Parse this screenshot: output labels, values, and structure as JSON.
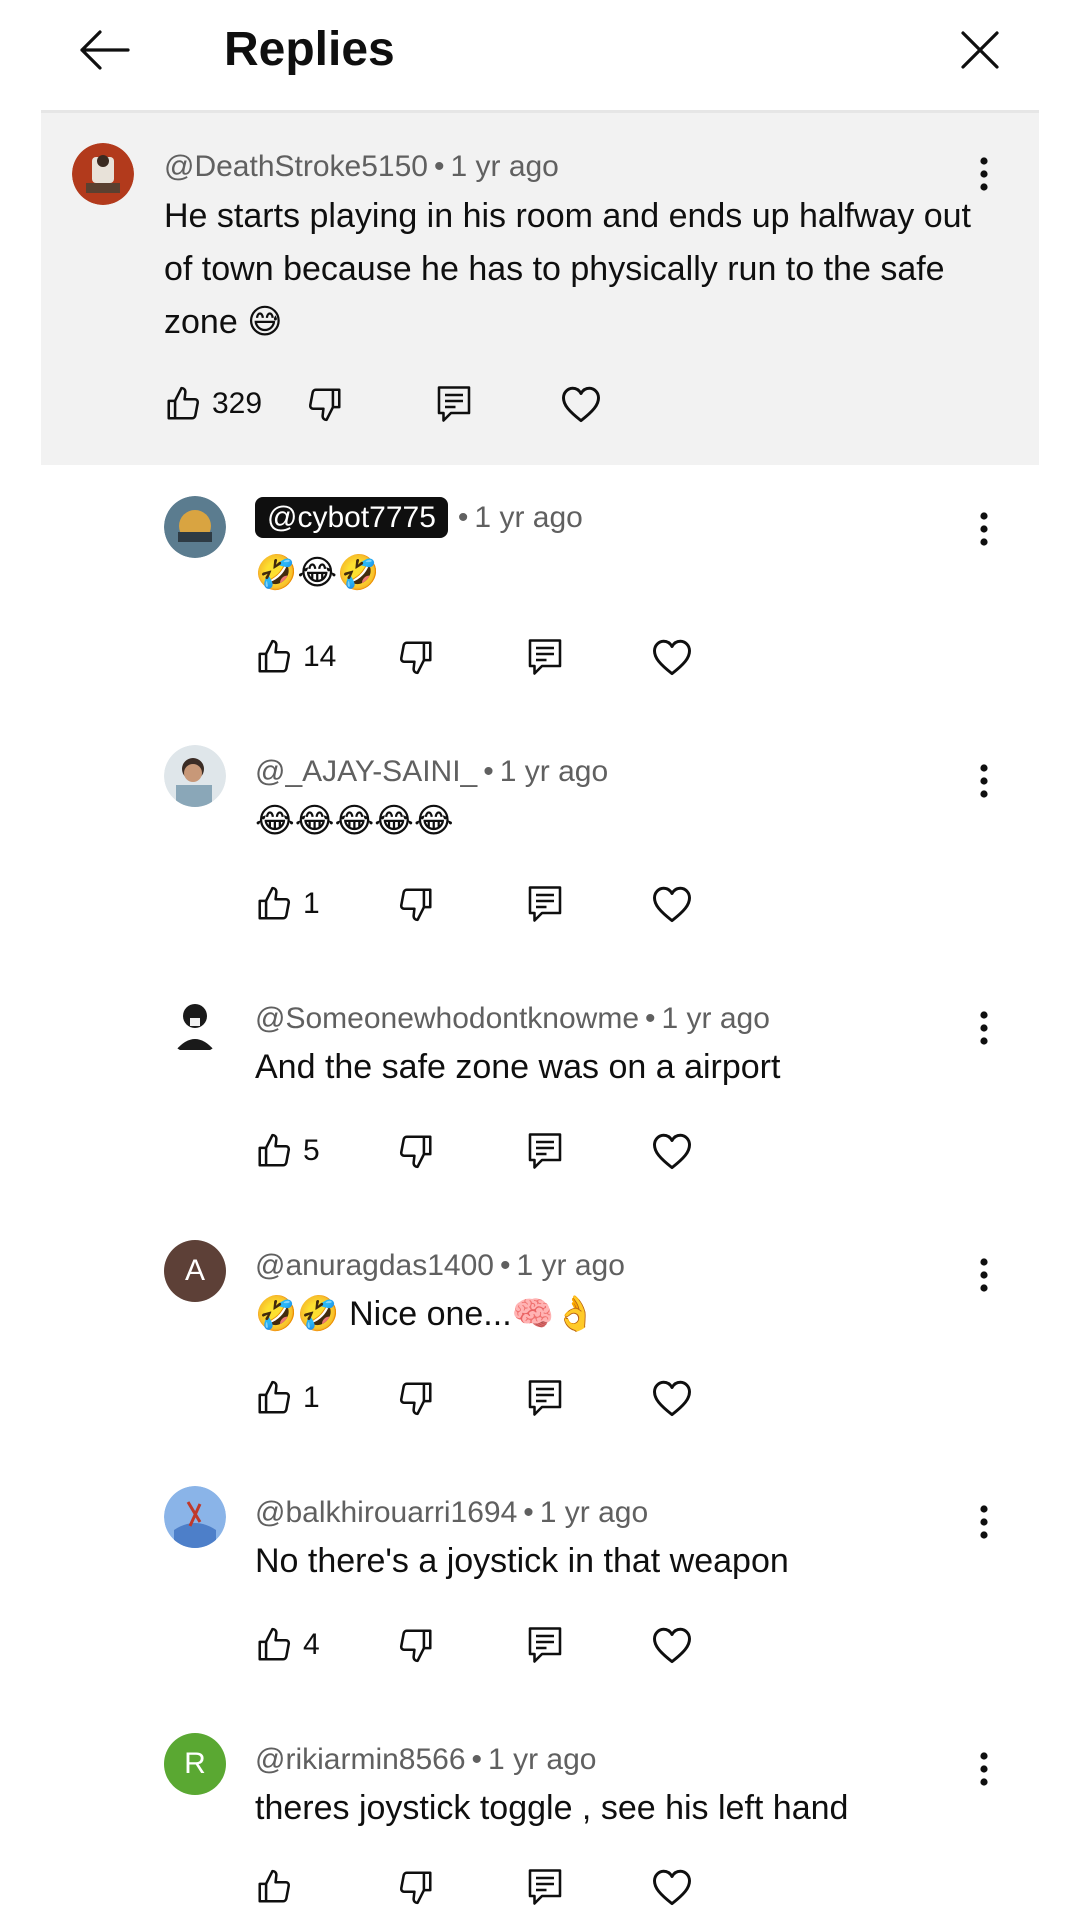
{
  "header": {
    "title": "Replies",
    "back_icon": "arrow-left-icon",
    "close_icon": "close-icon"
  },
  "parent_comment": {
    "handle": "@DeathStroke5150",
    "time": "1 yr ago",
    "text": "He starts playing in his room and ends up halfway out of town because he has to physically run to the safe zone 😅",
    "likes": "329"
  },
  "replies": [
    {
      "handle": "@cybot7775",
      "time": "1 yr ago",
      "text": "🤣😂🤣",
      "likes": "14",
      "highlight_handle": true
    },
    {
      "handle": "@_AJAY-SAINI_",
      "time": "1 yr ago",
      "text": "😂😂😂😂😂",
      "likes": "1"
    },
    {
      "handle": "@Someonewhodontknowme",
      "time": "1 yr ago",
      "text": "And the safe zone was on a airport",
      "likes": "5"
    },
    {
      "handle": "@anuragdas1400",
      "time": "1 yr ago",
      "text": "🤣🤣 Nice one...🧠👌",
      "likes": "1",
      "avatar_letter": "A",
      "avatar_color": "#5d4037"
    },
    {
      "handle": "@balkhirouarri1694",
      "time": "1 yr ago",
      "text": "No there's a joystick in that weapon",
      "likes": "4"
    },
    {
      "handle": "@rikiarmin8566",
      "time": "1 yr ago",
      "text": "theres joystick toggle , see his left hand",
      "likes": "",
      "avatar_letter": "R",
      "avatar_color": "#5aa832"
    }
  ],
  "separator": "•",
  "colors": {
    "pill_bg": "#0f0f0f",
    "parent_bg": "#f2f2f2",
    "meta_text": "#606060"
  },
  "icons": [
    "like-icon",
    "dislike-icon",
    "reply-icon",
    "heart-icon",
    "more-vert-icon"
  ]
}
